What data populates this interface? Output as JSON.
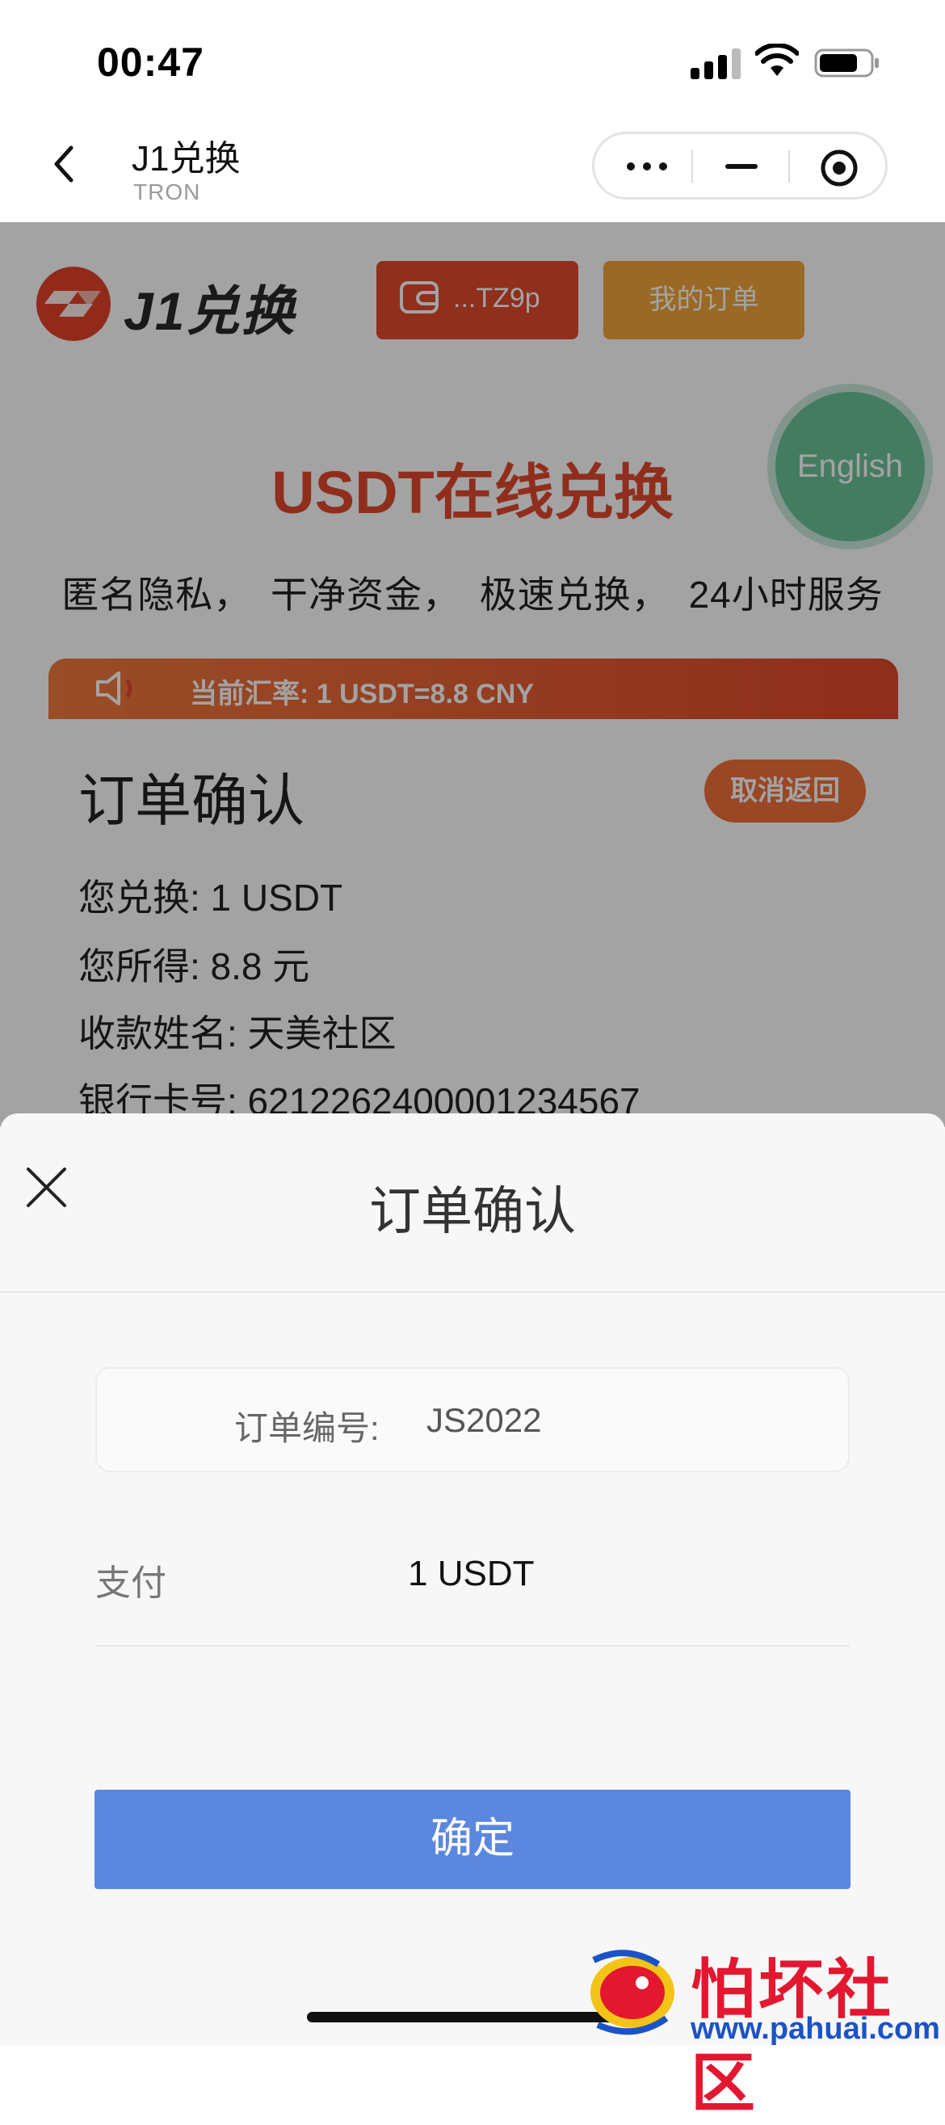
{
  "status_bar": {
    "time": "00:47"
  },
  "nav": {
    "title": "J1兑换",
    "subtitle": "TRON"
  },
  "page": {
    "logo_text": "J1兑换",
    "wallet_label": "...TZ9p",
    "orders_label": "我的订单",
    "language_label": "English",
    "headline": "USDT在线兑换",
    "tagline": "匿名隐私， 干净资金， 极速兑换， 24小时服务",
    "rate_text": "当前汇率: 1 USDT=8.8 CNY",
    "card_title": "订单确认",
    "cancel_label": "取消返回",
    "details": [
      "您兑换: 1 USDT",
      "您所得: 8.8 元",
      "收款姓名: 天美社区",
      "银行卡号: 6212262400001234567"
    ]
  },
  "sheet": {
    "title": "订单确认",
    "order_label": "订单编号:",
    "order_value": "JS2022",
    "pay_label": "支付",
    "pay_value": "1 USDT",
    "confirm_label": "确定"
  },
  "watermark": {
    "brand": "怕坏社区",
    "url": "www.pahuai.com"
  },
  "colors": {
    "accent_red": "#e04a2c",
    "accent_orange": "#f0a43a",
    "language_green": "#6bc29a",
    "confirm_blue": "#5b87df"
  }
}
